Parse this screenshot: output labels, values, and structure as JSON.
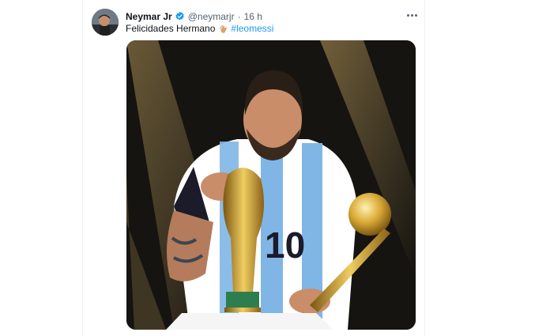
{
  "tweet": {
    "author_name": "Neymar Jr",
    "handle": "@neymarjr",
    "separator": "·",
    "time": "16 h",
    "text": "Felicidades Hermano",
    "hashtag": "#leomessi",
    "verified": true
  },
  "icons": {
    "verified": "verified-badge-icon",
    "clap": "clapping-hands-emoji",
    "more": "more-options-icon"
  },
  "colors": {
    "accent": "#1d9bf0",
    "text_primary": "#0f1419",
    "text_secondary": "#536471"
  }
}
